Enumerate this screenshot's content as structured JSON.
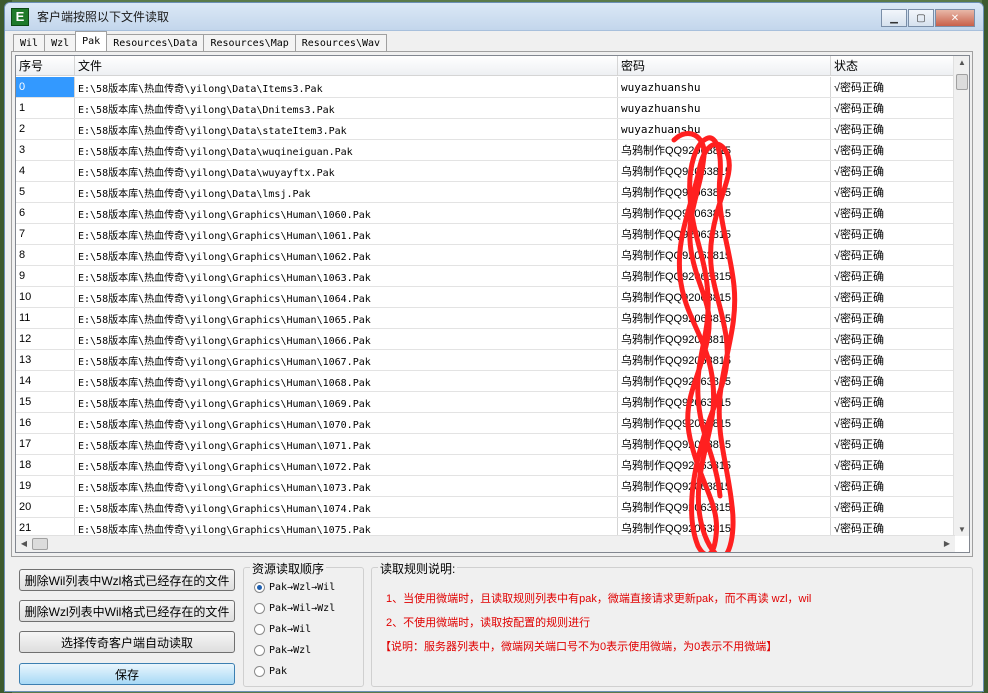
{
  "window": {
    "icon_letter": "E",
    "title": "客户端按照以下文件读取",
    "min": "▁",
    "max": "▢",
    "close": "✕"
  },
  "tabs": [
    "Wil",
    "Wzl",
    "Pak",
    "Resources\\Data",
    "Resources\\Map",
    "Resources\\Wav"
  ],
  "active_tab": 2,
  "grid": {
    "headers": [
      "序号",
      "文件",
      "密码",
      "状态"
    ],
    "rows": [
      [
        "0",
        "E:\\58版本库\\热血传奇\\yilong\\Data\\Items3.Pak",
        "wuyazhuanshu",
        "√密码正确"
      ],
      [
        "1",
        "E:\\58版本库\\热血传奇\\yilong\\Data\\Dnitems3.Pak",
        "wuyazhuanshu",
        "√密码正确"
      ],
      [
        "2",
        "E:\\58版本库\\热血传奇\\yilong\\Data\\stateItem3.Pak",
        "wuyazhuanshu",
        "√密码正确"
      ],
      [
        "3",
        "E:\\58版本库\\热血传奇\\yilong\\Data\\wuqineiguan.Pak",
        "乌鸦制作QQ92063815",
        "√密码正确"
      ],
      [
        "4",
        "E:\\58版本库\\热血传奇\\yilong\\Data\\wuyayftx.Pak",
        "乌鸦制作QQ92063815",
        "√密码正确"
      ],
      [
        "5",
        "E:\\58版本库\\热血传奇\\yilong\\Data\\lmsj.Pak",
        "乌鸦制作QQ92063815",
        "√密码正确"
      ],
      [
        "6",
        "E:\\58版本库\\热血传奇\\yilong\\Graphics\\Human\\1060.Pak",
        "乌鸦制作QQ92063815",
        "√密码正确"
      ],
      [
        "7",
        "E:\\58版本库\\热血传奇\\yilong\\Graphics\\Human\\1061.Pak",
        "乌鸦制作QQ92063815",
        "√密码正确"
      ],
      [
        "8",
        "E:\\58版本库\\热血传奇\\yilong\\Graphics\\Human\\1062.Pak",
        "乌鸦制作QQ92063815",
        "√密码正确"
      ],
      [
        "9",
        "E:\\58版本库\\热血传奇\\yilong\\Graphics\\Human\\1063.Pak",
        "乌鸦制作QQ92063815",
        "√密码正确"
      ],
      [
        "10",
        "E:\\58版本库\\热血传奇\\yilong\\Graphics\\Human\\1064.Pak",
        "乌鸦制作QQ92063815",
        "√密码正确"
      ],
      [
        "11",
        "E:\\58版本库\\热血传奇\\yilong\\Graphics\\Human\\1065.Pak",
        "乌鸦制作QQ92063815",
        "√密码正确"
      ],
      [
        "12",
        "E:\\58版本库\\热血传奇\\yilong\\Graphics\\Human\\1066.Pak",
        "乌鸦制作QQ92063815",
        "√密码正确"
      ],
      [
        "13",
        "E:\\58版本库\\热血传奇\\yilong\\Graphics\\Human\\1067.Pak",
        "乌鸦制作QQ92063815",
        "√密码正确"
      ],
      [
        "14",
        "E:\\58版本库\\热血传奇\\yilong\\Graphics\\Human\\1068.Pak",
        "乌鸦制作QQ92063815",
        "√密码正确"
      ],
      [
        "15",
        "E:\\58版本库\\热血传奇\\yilong\\Graphics\\Human\\1069.Pak",
        "乌鸦制作QQ92063815",
        "√密码正确"
      ],
      [
        "16",
        "E:\\58版本库\\热血传奇\\yilong\\Graphics\\Human\\1070.Pak",
        "乌鸦制作QQ92063815",
        "√密码正确"
      ],
      [
        "17",
        "E:\\58版本库\\热血传奇\\yilong\\Graphics\\Human\\1071.Pak",
        "乌鸦制作QQ92063815",
        "√密码正确"
      ],
      [
        "18",
        "E:\\58版本库\\热血传奇\\yilong\\Graphics\\Human\\1072.Pak",
        "乌鸦制作QQ92063815",
        "√密码正确"
      ],
      [
        "19",
        "E:\\58版本库\\热血传奇\\yilong\\Graphics\\Human\\1073.Pak",
        "乌鸦制作QQ92063815",
        "√密码正确"
      ],
      [
        "20",
        "E:\\58版本库\\热血传奇\\yilong\\Graphics\\Human\\1074.Pak",
        "乌鸦制作QQ92063815",
        "√密码正确"
      ],
      [
        "21",
        "E:\\58版本库\\热血传奇\\yilong\\Graphics\\Human\\1075.Pak",
        "乌鸦制作QQ92063815",
        "√密码正确"
      ]
    ],
    "selected_row": 0,
    "scroll_up": "▲",
    "scroll_down": "▼",
    "scroll_left": "◀",
    "scroll_right": "▶"
  },
  "buttons": {
    "delete_wil": "删除Wil列表中Wzl格式已经存在的文件",
    "delete_wzl": "删除Wzl列表中Wil格式已经存在的文件",
    "auto_read": "选择传奇客户端自动读取",
    "save": "保存"
  },
  "resource_order": {
    "title": "资源读取顺序",
    "options": [
      "Pak→Wzl→Wil",
      "Pak→Wil→Wzl",
      "Pak→Wil",
      "Pak→Wzl",
      "Pak"
    ],
    "selected": 0
  },
  "rules": {
    "title": "读取规则说明:",
    "lines": [
      "1、当使用微端时，且读取规则列表中有pak，微端直接请求更新pak，而不再读 wzl，wil",
      "2、不使用微端时，读取按配置的规则进行",
      "【说明：服务器列表中，微端网关端口号不为0表示使用微端，为0表示不用微端】"
    ]
  },
  "colors": {
    "accent": "#3399ff",
    "rule_text": "#e00000",
    "scribble": "#ff2020"
  }
}
